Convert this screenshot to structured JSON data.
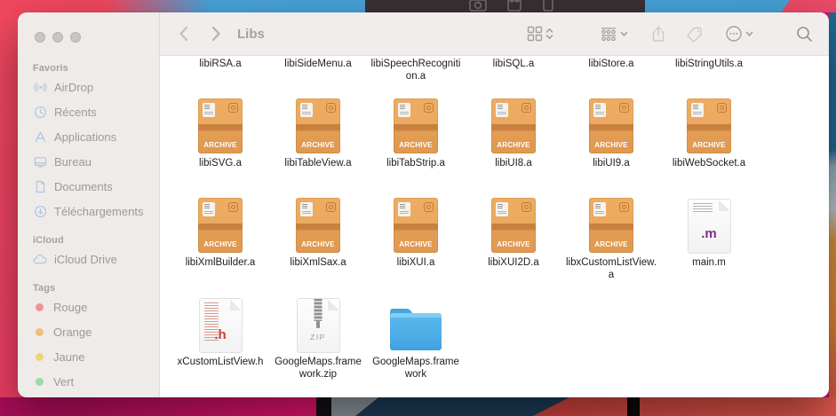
{
  "background": {
    "behind_window_bar_icons": [
      "camera",
      "bag",
      "device"
    ]
  },
  "window": {
    "traffic_lights": [
      "close",
      "minimize",
      "zoom"
    ]
  },
  "toolbar": {
    "title": "Libs",
    "icons": [
      "chevron-left",
      "chevron-right",
      "icon-view",
      "group-by",
      "share",
      "tag",
      "more-options",
      "search"
    ]
  },
  "sidebar": {
    "sections": [
      {
        "header": "Favoris",
        "items": [
          {
            "label": "AirDrop",
            "icon": "airdrop"
          },
          {
            "label": "Récents",
            "icon": "clock"
          },
          {
            "label": "Applications",
            "icon": "applications"
          },
          {
            "label": "Bureau",
            "icon": "desktop"
          },
          {
            "label": "Documents",
            "icon": "document"
          },
          {
            "label": "Téléchargements",
            "icon": "download"
          }
        ]
      },
      {
        "header": "iCloud",
        "items": [
          {
            "label": "iCloud Drive",
            "icon": "cloud"
          }
        ]
      }
    ],
    "tags_section": {
      "header": "Tags",
      "items": [
        {
          "label": "Rouge",
          "color": "#f09494"
        },
        {
          "label": "Orange",
          "color": "#f2bd80"
        },
        {
          "label": "Jaune",
          "color": "#eed57a"
        },
        {
          "label": "Vert",
          "color": "#9cd8a8"
        }
      ]
    }
  },
  "file_icon_labels": {
    "archive": "ARCHIVE",
    "zip": "ZIP",
    "m_ext": ".m",
    "h_ext": ".h"
  },
  "files": [
    {
      "name": "libiRSA.a",
      "type": "label_only"
    },
    {
      "name": "libiSideMenu.a",
      "type": "label_only"
    },
    {
      "name": "libiSpeechRecognition.a",
      "type": "label_only"
    },
    {
      "name": "libiSQL.a",
      "type": "label_only"
    },
    {
      "name": "libiStore.a",
      "type": "label_only"
    },
    {
      "name": "libiStringUtils.a",
      "type": "label_only"
    },
    {
      "name": "libiSVG.a",
      "type": "archive"
    },
    {
      "name": "libiTableView.a",
      "type": "archive"
    },
    {
      "name": "libiTabStrip.a",
      "type": "archive"
    },
    {
      "name": "libiUI8.a",
      "type": "archive"
    },
    {
      "name": "libiUI9.a",
      "type": "archive"
    },
    {
      "name": "libiWebSocket.a",
      "type": "archive"
    },
    {
      "name": "libiXmlBuilder.a",
      "type": "archive"
    },
    {
      "name": "libiXmlSax.a",
      "type": "archive"
    },
    {
      "name": "libiXUI.a",
      "type": "archive"
    },
    {
      "name": "libiXUI2D.a",
      "type": "archive"
    },
    {
      "name": "libxCustomListView.a",
      "type": "archive"
    },
    {
      "name": "main.m",
      "type": "mfile"
    },
    {
      "name": "xCustomListView.h",
      "type": "hfile"
    },
    {
      "name": "GoogleMaps.framework.zip",
      "type": "zip"
    },
    {
      "name": "GoogleMaps.framework",
      "type": "folder"
    }
  ]
}
